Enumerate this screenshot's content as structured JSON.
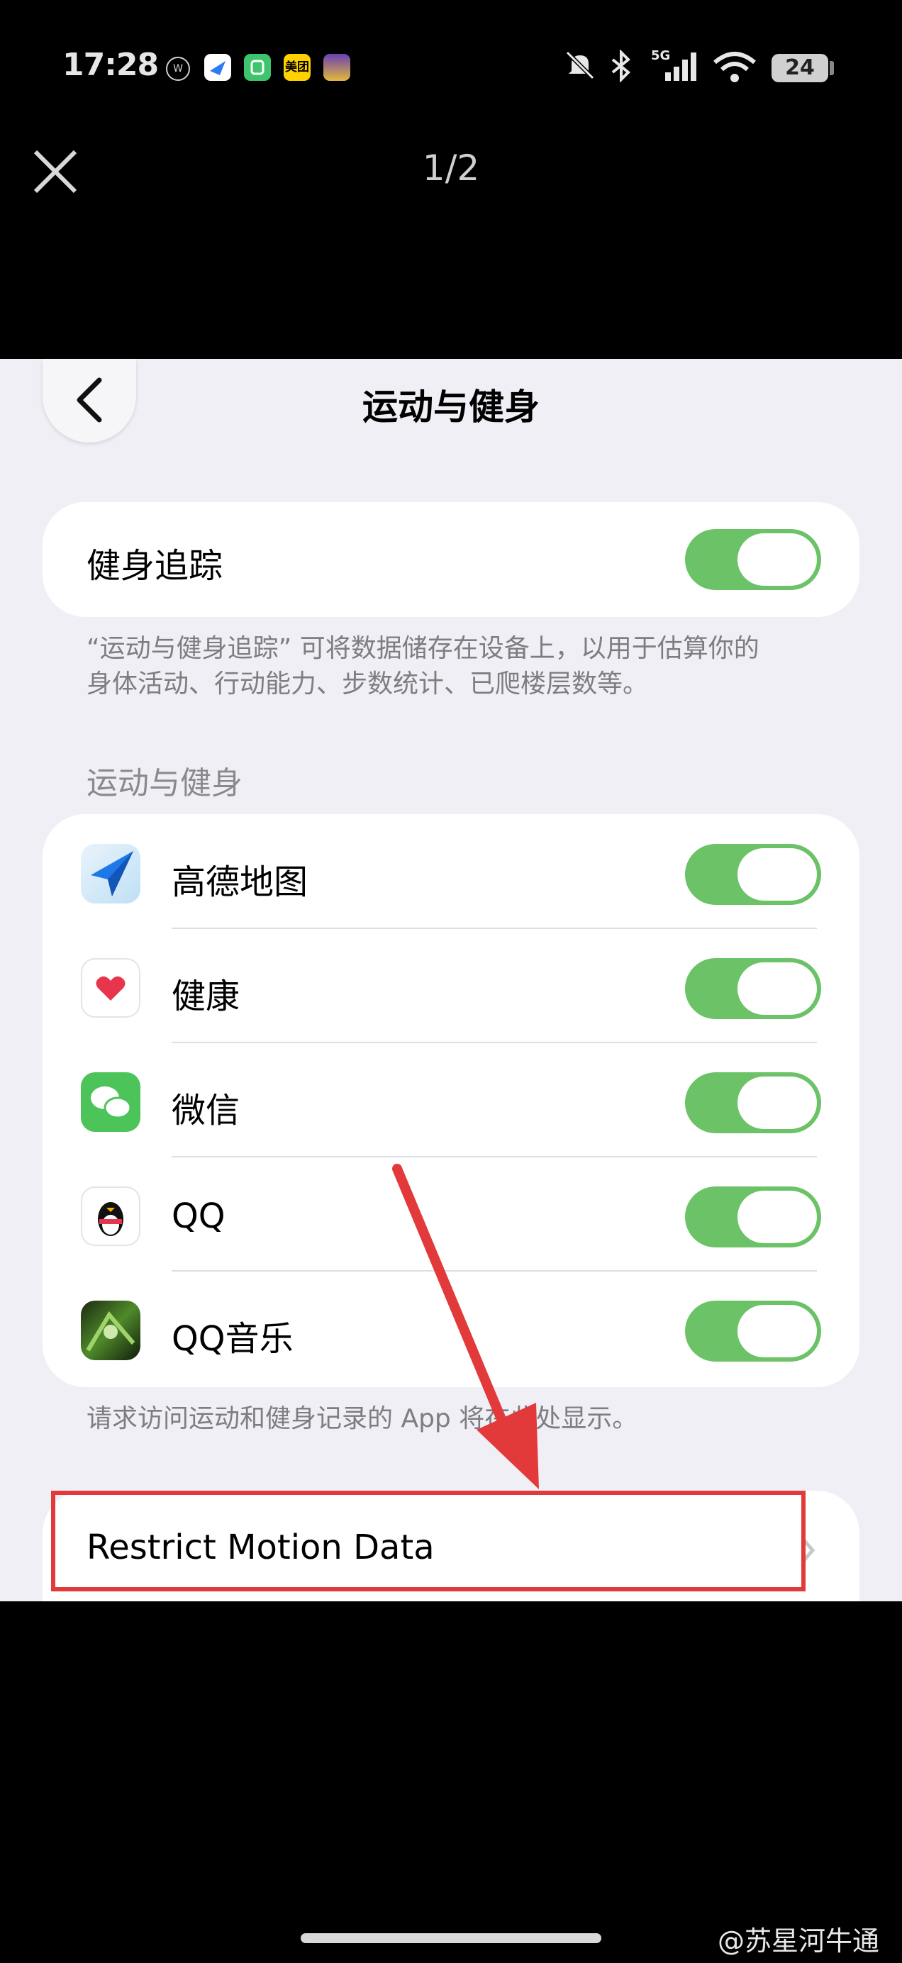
{
  "status_bar": {
    "time": "17:28",
    "network": "5G",
    "battery": "24",
    "icons": [
      "weibo-icon",
      "dingtalk-icon",
      "miui-icon",
      "meituan-icon",
      "game-icon",
      "mute-icon",
      "bluetooth-icon",
      "signal-icon",
      "wifi-icon",
      "battery-icon"
    ],
    "app_labels": {
      "meituan": "美团"
    }
  },
  "viewer": {
    "counter": "1/2"
  },
  "screen": {
    "title": "运动与健身",
    "fitness_tracking": {
      "label": "健身追踪",
      "on": true
    },
    "tracking_footnote_line1": "“运动与健身追踪” 可将数据储存在设备上，以用于估算你的",
    "tracking_footnote_line2": "身体活动、行动能力、步数统计、已爬楼层数等。",
    "section_header": "运动与健身",
    "apps": [
      {
        "name": "高德地图",
        "on": true,
        "icon": "amap-icon"
      },
      {
        "name": "健康",
        "on": true,
        "icon": "health-icon"
      },
      {
        "name": "微信",
        "on": true,
        "icon": "wechat-icon"
      },
      {
        "name": "QQ",
        "on": true,
        "icon": "qq-icon"
      },
      {
        "name": "QQ音乐",
        "on": true,
        "icon": "qqmusic-icon"
      }
    ],
    "apps_footnote": "请求访问运动和健身记录的 App 将在此处显示。",
    "restrict_motion_label": "Restrict Motion Data"
  },
  "watermark": "@苏星河牛通",
  "colors": {
    "toggle_on": "#6bc267",
    "annotation_red": "#e23a3a",
    "background": "#f0eff5"
  }
}
